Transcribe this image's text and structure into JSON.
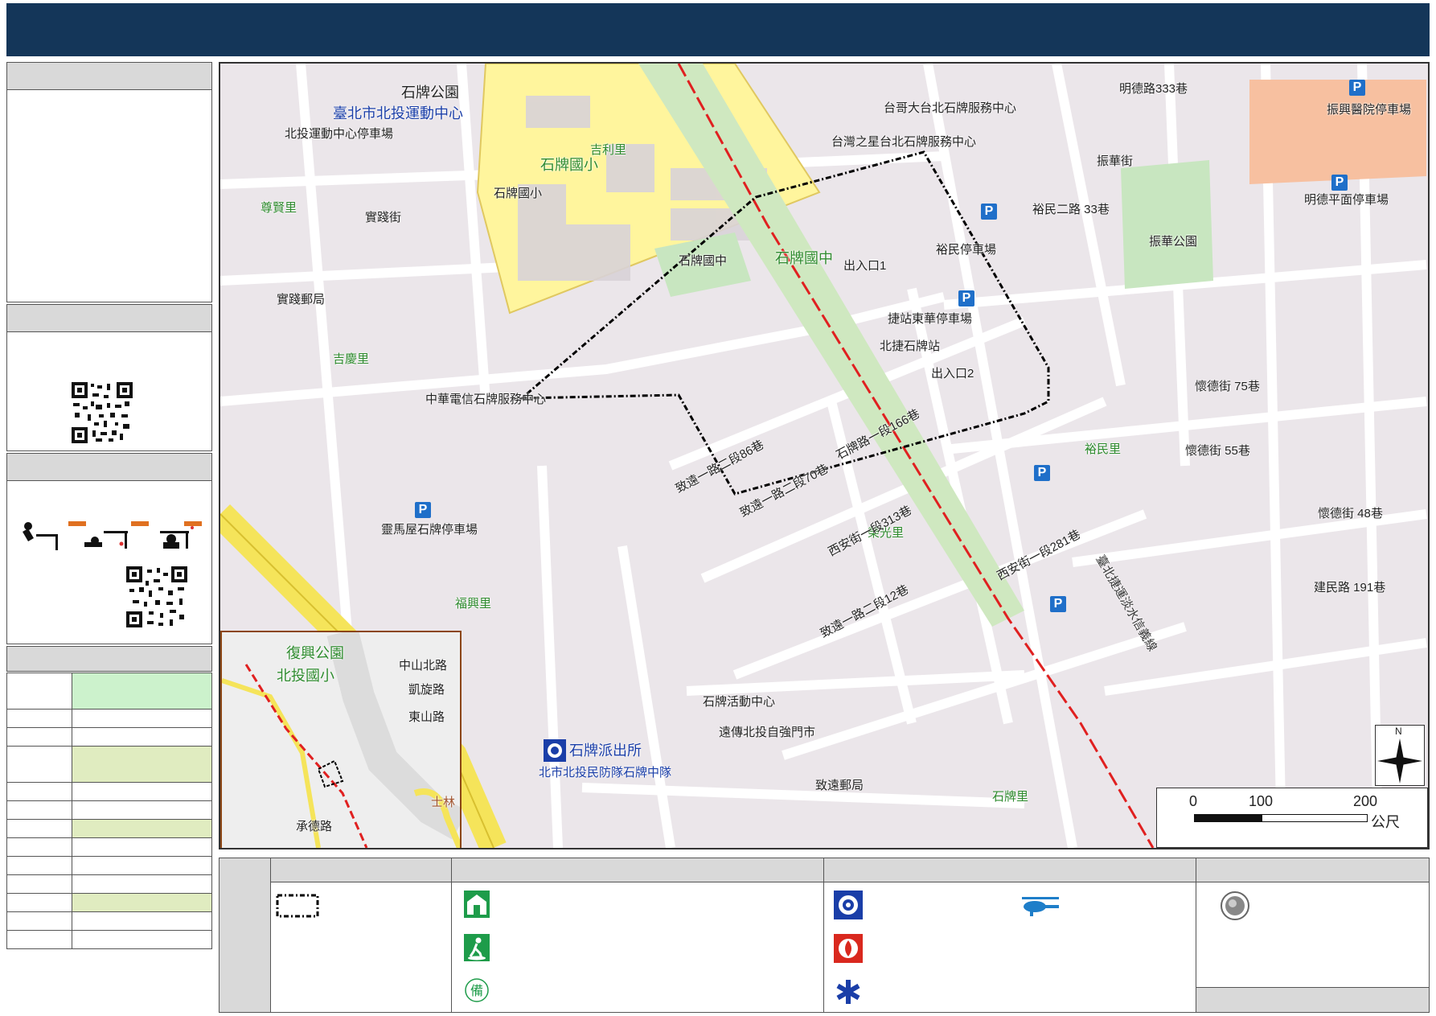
{
  "map": {
    "labels": {
      "shipai_park": "石牌公園",
      "beitou_sports_center": "臺北市北投運動中心",
      "beitou_sports_parking": "北投運動中心停車場",
      "shipai_elementary": "石牌國小",
      "shipai_elementary_small": "石牌國小",
      "jili_li": "吉利里",
      "zunxian_li": "尊賢里",
      "shijian_st": "實踐街",
      "shijian_post": "實踐郵局",
      "jiqing_li": "吉慶里",
      "shipai_junior": "石牌國中",
      "shipai_junior_small": "石牌國中",
      "exit1": "出入口1",
      "exit2": "出入口2",
      "station": "北捷石牌站",
      "station_parking": "捷站東華停車場",
      "yumin_parking": "裕民停車場",
      "zhenhua_park": "振華公園",
      "zhenhua_st": "振華街",
      "yumin_li": "裕民里",
      "rongguang_li": "榮光里",
      "fuxing_li": "福興里",
      "shipai_li": "石牌里",
      "lingma_parking": "靈馬屋石牌停車場",
      "zhiyuan_post": "致遠郵局",
      "mrt_line": "臺北捷運淡水信義線",
      "police_station": "石牌派出所",
      "police_team": "北市北投民防隊石牌中隊",
      "chunghwa_telecom": "中華電信石牌服務中心",
      "taiwan_star": "台灣之星台北石牌服務中心",
      "taiwan_big_brother": "台哥大台北石牌服務中心",
      "shipai_activity": "石牌活動中心",
      "fareastone": "遠傳北投自強門市",
      "zhiyuan_rd": "致遠一路二段70巷",
      "shipai_rd": "石牌路一段166巷",
      "xian_st": "西安街一段313巷",
      "zhiyuan_86": "致遠一路二段86巷",
      "zhiyuan_12": "致遠一路二段12巷",
      "xian_281": "西安街一段281巷",
      "mingde_parking": "明德平面停車場",
      "zhenxing_parking": "振興醫院停車場",
      "mingde_ave": "明德路333巷",
      "huaide_75": "懷德街 75巷",
      "huaide_55": "懷德街 55巷",
      "huaide_48": "懷德街 48巷",
      "jianmin_191": "建民路 191巷",
      "yumin_row": "裕民二路 33巷"
    },
    "inset": {
      "fuxing_park": "復興公園",
      "beitou_elementary": "北投國小",
      "zhongshan_n": "中山北路",
      "kaixuan": "凱旋路",
      "dongshan": "東山路",
      "chengde": "承德路",
      "shilin": "士林"
    },
    "scale": {
      "ticks": [
        "0",
        "100",
        "200"
      ],
      "unit": "公尺"
    },
    "north_label": "N",
    "colors": {
      "header": "#143659",
      "mrt_line": "#e02020",
      "school": "#fff59d",
      "park": "#c8e6c0",
      "block": "#d9d3d8",
      "road_major": "#f5e45a",
      "boundary": "#000000"
    }
  },
  "status_table": {
    "row_colors": [
      "#ccf2cc",
      "#ffffff",
      "#ffffff",
      "#e0ecc0",
      "#ffffff",
      "#ffffff",
      "#e0ecc0",
      "#ffffff",
      "#ffffff",
      "#e0ecc0",
      "#ffffff",
      "#ffffff"
    ]
  },
  "legend": {
    "icons": [
      "boundary-icon",
      "shelter-icon",
      "evacuation-icon",
      "standby-icon",
      "police-icon",
      "fire-icon",
      "medical-icon",
      "helicopter-icon",
      "landmark-icon"
    ]
  }
}
